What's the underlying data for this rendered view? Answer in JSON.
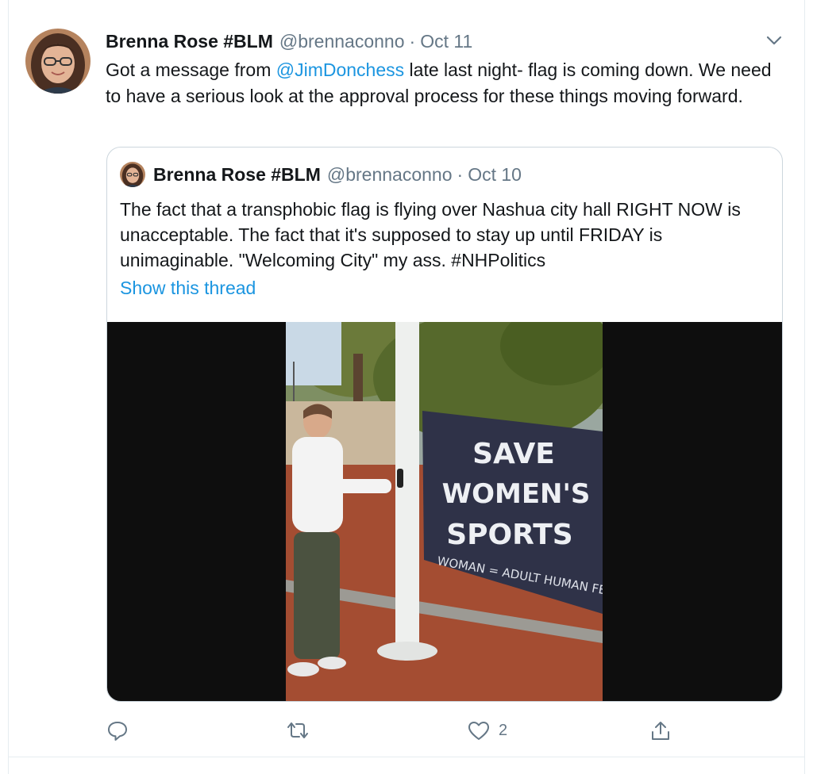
{
  "tweet": {
    "author_name": "Brenna Rose #BLM",
    "handle": "@brennaconno",
    "separator": "·",
    "date": "Oct 11",
    "text_before": "Got a message from ",
    "mention": "@JimDonchess",
    "text_after": " late last night- flag is coming down. We need to have a serious look at the approval process for these things moving forward."
  },
  "quoted_tweet": {
    "author_name": "Brenna Rose #BLM",
    "handle": "@brennaconno",
    "separator": "·",
    "date": "Oct 10",
    "text": "The fact that a transphobic flag is flying over Nashua city hall RIGHT NOW is unacceptable. The fact that it's supposed to stay up until FRIDAY is unimaginable. \"Welcoming City\" my ass. #NHPolitics",
    "show_thread_label": "Show this thread",
    "media": {
      "banner_lines": [
        "SAVE",
        "WOMEN'S",
        "SPORTS"
      ],
      "banner_subtext": "WOMAN = ADULT HUMAN FEM"
    }
  },
  "actions": {
    "reply_icon": "reply-icon",
    "retweet_icon": "retweet-icon",
    "like_icon": "heart-icon",
    "like_count": "2",
    "share_icon": "share-icon"
  },
  "colors": {
    "link": "#1b95e0",
    "secondary_text": "#657786",
    "border": "#ccd6dd"
  }
}
